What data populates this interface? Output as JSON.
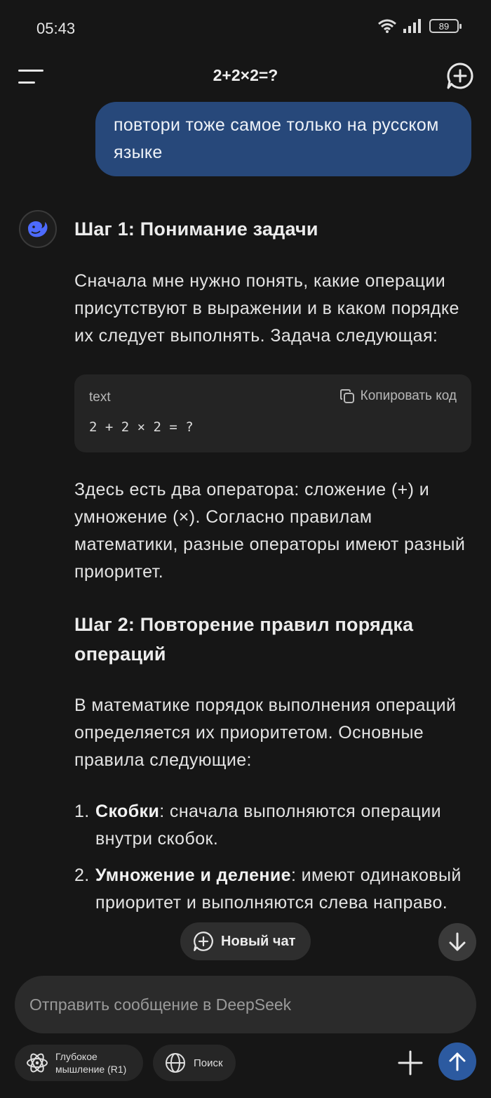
{
  "status_bar": {
    "time": "05:43",
    "battery": "89"
  },
  "header": {
    "title": "2+2×2=?"
  },
  "user_message": "повтори тоже самое только на русском языке",
  "assistant": {
    "heading1": "Шаг 1: Понимание задачи",
    "para1": "Сначала мне нужно понять, какие операции присутствуют в выражении и в каком порядке их следует выполнять. Задача следующая:",
    "code": {
      "lang": "text",
      "copy_label": "Копировать код",
      "content": "2 + 2 × 2 = ?"
    },
    "para2": "Здесь есть два оператора: сложение (+) и умножение (×). Согласно правилам математики, разные операторы имеют разный приоритет.",
    "heading2": "Шаг 2: Повторение правил порядка операций",
    "para3": "В математике порядок выполнения операций определяется их приоритетом. Основные правила следующие:",
    "rules": [
      {
        "num": "1.",
        "bold": "Скобки",
        "text": ": сначала выполняются операции внутри скобок."
      },
      {
        "num": "2.",
        "bold": "Умножение и деление",
        "text": ": имеют одинаковый приоритет и выполняются слева направо."
      }
    ]
  },
  "new_chat_pill": "Новый чат",
  "input": {
    "placeholder": "Отправить сообщение в DeepSeek"
  },
  "chips": {
    "deep_think": "Глубокое мышление (R1)",
    "search": "Поиск"
  },
  "colors": {
    "background": "#161616",
    "user_bubble": "#27487a",
    "accent": "#2c5aa0",
    "whale": "#4d6bfe"
  }
}
